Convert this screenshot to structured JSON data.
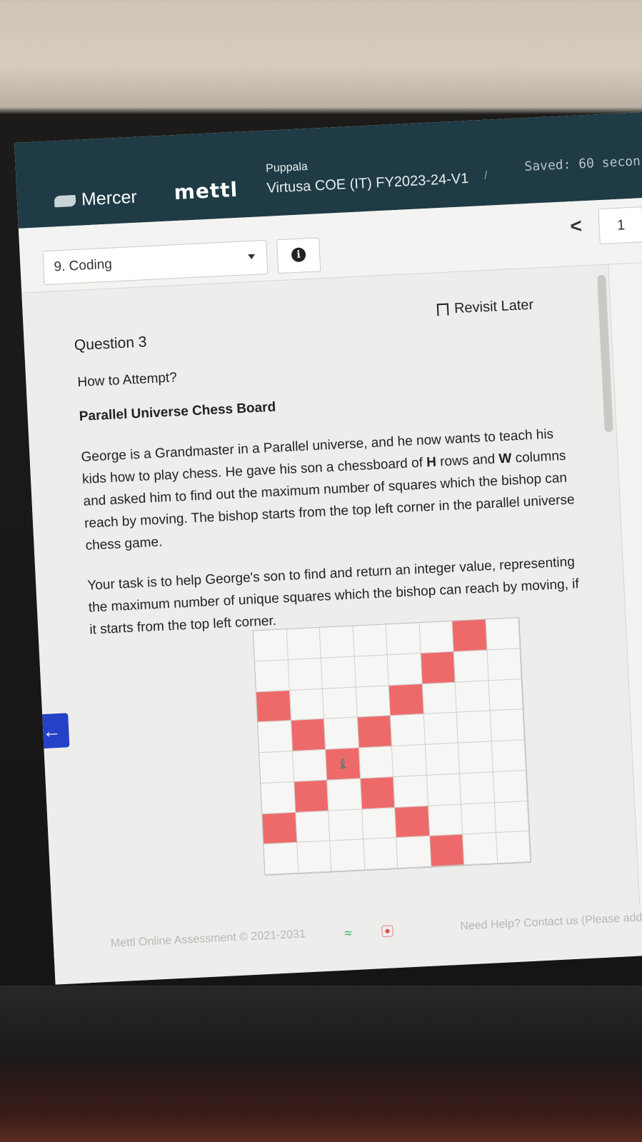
{
  "header": {
    "brand": "Mercer",
    "product": "mettl",
    "candidate_name": "Puppala",
    "test_name": "Virtusa COE (IT) FY2023-24-V1",
    "separator": "/",
    "saved_status": "Saved: 60 secon"
  },
  "toolbar": {
    "section_label": "9. Coding",
    "info_icon": "i",
    "prev_label": "<",
    "current_page": "1"
  },
  "question": {
    "number_label": "Question 3",
    "revisit_label": "Revisit Later",
    "how_to_attempt": "How to Attempt?",
    "title": "Parallel Universe Chess Board",
    "para1_a": "George is a Grandmaster in a Parallel universe, and he now wants to teach his kids how to play chess. He gave his son a chessboard of ",
    "para1_h": "H",
    "para1_b": " rows and ",
    "para1_w": "W",
    "para1_c": " columns and asked him to find out the maximum number of squares which the bishop can reach by moving. The bishop starts from the top left corner in the parallel universe chess game.",
    "para2": "Your task is to help George's son to find and return an integer value, representing the maximum number of unique squares which the bishop can reach by moving, if it starts from the top left corner."
  },
  "board": {
    "rows": 8,
    "cols": 8,
    "highlight_color": "#ee6a6a",
    "highlighted": [
      [
        0,
        6
      ],
      [
        1,
        5
      ],
      [
        2,
        0
      ],
      [
        2,
        4
      ],
      [
        3,
        1
      ],
      [
        3,
        3
      ],
      [
        4,
        2
      ],
      [
        5,
        1
      ],
      [
        5,
        3
      ],
      [
        6,
        0
      ],
      [
        6,
        4
      ],
      [
        7,
        5
      ]
    ],
    "bishop_position": [
      4,
      2
    ],
    "bishop_icon": "bishop-icon"
  },
  "footer": {
    "copyright": "Mettl Online Assessment © 2021-2031",
    "help": "Need Help? Contact us (Please add"
  },
  "nav": {
    "back_arrow": "←"
  }
}
